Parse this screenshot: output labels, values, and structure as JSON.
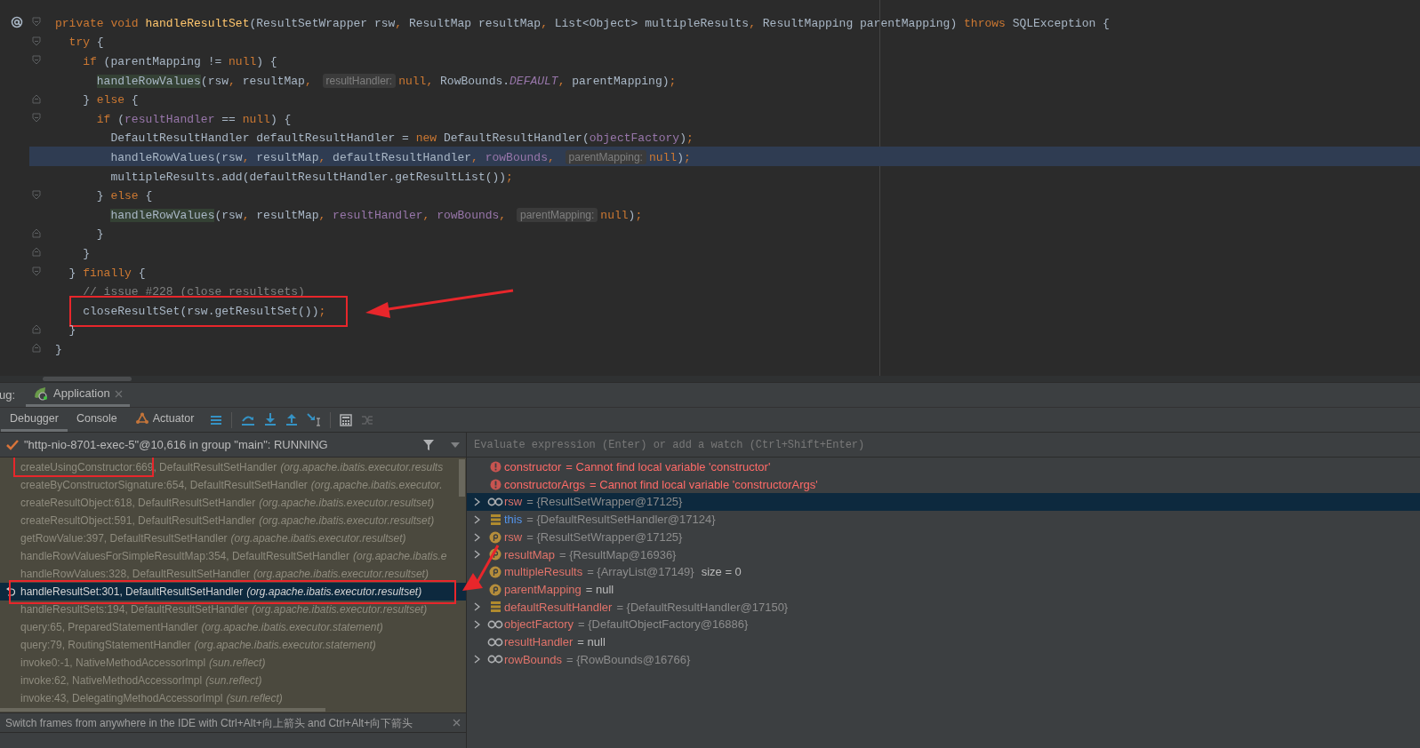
{
  "editor": {
    "lines": [
      {
        "override_marker": true,
        "fold": {
          "kind": "open"
        },
        "current": false,
        "boxed": false,
        "tokens": [
          {
            "kind": "kw",
            "text": "private void "
          },
          {
            "kind": "decl",
            "text": "handleResultSet"
          },
          {
            "kind": "plain",
            "text": "(ResultSetWrapper rsw"
          },
          {
            "kind": "punct",
            "text": ", "
          },
          {
            "kind": "plain",
            "text": "ResultMap resultMap"
          },
          {
            "kind": "punct",
            "text": ", "
          },
          {
            "kind": "plain",
            "text": "List<Object> multipleResults"
          },
          {
            "kind": "punct",
            "text": ", "
          },
          {
            "kind": "plain",
            "text": "ResultMapping parentMapping) "
          },
          {
            "kind": "kw",
            "text": "throws "
          },
          {
            "kind": "plain",
            "text": "SQLException {"
          }
        ]
      },
      {
        "override_marker": false,
        "fold": {
          "kind": "open"
        },
        "current": false,
        "boxed": false,
        "tokens": [
          {
            "kind": "kw",
            "text": "  try "
          },
          {
            "kind": "plain",
            "text": "{"
          }
        ]
      },
      {
        "override_marker": false,
        "fold": {
          "kind": "open"
        },
        "current": false,
        "boxed": false,
        "tokens": [
          {
            "kind": "kw",
            "text": "    if "
          },
          {
            "kind": "plain",
            "text": "(parentMapping != "
          },
          {
            "kind": "kw",
            "text": "null"
          },
          {
            "kind": "plain",
            "text": ") {"
          }
        ]
      },
      {
        "override_marker": false,
        "current": false,
        "boxed": false,
        "tokens": [
          {
            "kind": "usage",
            "text": "      handleRowValues"
          },
          {
            "kind": "plain",
            "text": "(rsw"
          },
          {
            "kind": "punct",
            "text": ", "
          },
          {
            "kind": "plain",
            "text": "resultMap"
          },
          {
            "kind": "punct",
            "text": ", "
          },
          {
            "kind": "hint",
            "text": "resultHandler:"
          },
          {
            "kind": "kw",
            "text": "null"
          },
          {
            "kind": "punct",
            "text": ", "
          },
          {
            "kind": "plain",
            "text": "RowBounds."
          },
          {
            "kind": "const",
            "text": "DEFAULT"
          },
          {
            "kind": "punct",
            "text": ", "
          },
          {
            "kind": "plain",
            "text": "parentMapping)"
          },
          {
            "kind": "punct",
            "text": ";"
          }
        ]
      },
      {
        "override_marker": false,
        "fold": {
          "kind": "close"
        },
        "current": false,
        "boxed": false,
        "tokens": [
          {
            "kind": "plain",
            "text": "    } "
          },
          {
            "kind": "kw",
            "text": "else "
          },
          {
            "kind": "plain",
            "text": "{"
          }
        ]
      },
      {
        "override_marker": false,
        "fold": {
          "kind": "open"
        },
        "current": false,
        "boxed": false,
        "tokens": [
          {
            "kind": "kw",
            "text": "      if "
          },
          {
            "kind": "plain",
            "text": "("
          },
          {
            "kind": "field",
            "text": "resultHandler"
          },
          {
            "kind": "plain",
            "text": " == "
          },
          {
            "kind": "kw",
            "text": "null"
          },
          {
            "kind": "plain",
            "text": ") {"
          }
        ]
      },
      {
        "override_marker": false,
        "current": false,
        "boxed": false,
        "tokens": [
          {
            "kind": "plain",
            "text": "        DefaultResultHandler defaultResultHandler = "
          },
          {
            "kind": "kw",
            "text": "new "
          },
          {
            "kind": "plain",
            "text": "DefaultResultHandler("
          },
          {
            "kind": "field",
            "text": "objectFactory"
          },
          {
            "kind": "plain",
            "text": ")"
          },
          {
            "kind": "punct",
            "text": ";"
          }
        ]
      },
      {
        "override_marker": false,
        "current": true,
        "boxed": false,
        "tokens": [
          {
            "kind": "plain",
            "text": "        handleRowValues(rsw"
          },
          {
            "kind": "punct",
            "text": ", "
          },
          {
            "kind": "plain",
            "text": "resultMap"
          },
          {
            "kind": "punct",
            "text": ", "
          },
          {
            "kind": "plain",
            "text": "defaultResultHandler"
          },
          {
            "kind": "punct",
            "text": ", "
          },
          {
            "kind": "field",
            "text": "rowBounds"
          },
          {
            "kind": "punct",
            "text": ", "
          },
          {
            "kind": "hint",
            "text": "parentMapping:"
          },
          {
            "kind": "kw",
            "text": "null"
          },
          {
            "kind": "plain",
            "text": ")"
          },
          {
            "kind": "punct",
            "text": ";"
          }
        ]
      },
      {
        "override_marker": false,
        "current": false,
        "boxed": false,
        "tokens": [
          {
            "kind": "plain",
            "text": "        multipleResults.add(defaultResultHandler.getResultList())"
          },
          {
            "kind": "punct",
            "text": ";"
          }
        ]
      },
      {
        "override_marker": false,
        "fold": {
          "kind": "open"
        },
        "current": false,
        "boxed": false,
        "tokens": [
          {
            "kind": "plain",
            "text": "      } "
          },
          {
            "kind": "kw",
            "text": "else "
          },
          {
            "kind": "plain",
            "text": "{"
          }
        ]
      },
      {
        "override_marker": false,
        "current": false,
        "boxed": false,
        "tokens": [
          {
            "kind": "usage",
            "text": "        handleRowValues"
          },
          {
            "kind": "plain",
            "text": "(rsw"
          },
          {
            "kind": "punct",
            "text": ", "
          },
          {
            "kind": "plain",
            "text": "resultMap"
          },
          {
            "kind": "punct",
            "text": ", "
          },
          {
            "kind": "field",
            "text": "resultHandler"
          },
          {
            "kind": "punct",
            "text": ", "
          },
          {
            "kind": "field",
            "text": "rowBounds"
          },
          {
            "kind": "punct",
            "text": ", "
          },
          {
            "kind": "hint",
            "text": "parentMapping:"
          },
          {
            "kind": "kw",
            "text": "null"
          },
          {
            "kind": "plain",
            "text": ")"
          },
          {
            "kind": "punct",
            "text": ";"
          }
        ]
      },
      {
        "override_marker": false,
        "fold": {
          "kind": "close"
        },
        "current": false,
        "boxed": false,
        "tokens": [
          {
            "kind": "plain",
            "text": "      }"
          }
        ]
      },
      {
        "override_marker": false,
        "fold": {
          "kind": "close"
        },
        "current": false,
        "boxed": false,
        "tokens": [
          {
            "kind": "plain",
            "text": "    }"
          }
        ]
      },
      {
        "override_marker": false,
        "fold": {
          "kind": "open"
        },
        "current": false,
        "boxed": false,
        "tokens": [
          {
            "kind": "plain",
            "text": "  } "
          },
          {
            "kind": "kw",
            "text": "finally "
          },
          {
            "kind": "plain",
            "text": "{"
          }
        ]
      },
      {
        "override_marker": false,
        "current": false,
        "boxed": false,
        "tokens": [
          {
            "kind": "comment",
            "text": "    // issue #228 (close resultsets)"
          }
        ]
      },
      {
        "override_marker": false,
        "current": false,
        "boxed": true,
        "tokens": [
          {
            "kind": "plain",
            "text": "    closeResultSet(rsw.getResultSet())"
          },
          {
            "kind": "punct",
            "text": ";"
          }
        ]
      },
      {
        "override_marker": false,
        "fold": {
          "kind": "close"
        },
        "current": false,
        "boxed": false,
        "tokens": [
          {
            "kind": "plain",
            "text": "  }"
          }
        ]
      },
      {
        "override_marker": false,
        "fold": {
          "kind": "close"
        },
        "current": false,
        "boxed": false,
        "tokens": [
          {
            "kind": "plain",
            "text": "}"
          }
        ]
      }
    ]
  },
  "debug": {
    "title": "ug:",
    "sessions": [
      {
        "label": "Application",
        "selected": true
      }
    ],
    "tabs": [
      {
        "label": "Debugger",
        "selected": true,
        "kind": "plain"
      },
      {
        "label": "Console",
        "selected": false,
        "kind": "plain"
      },
      {
        "label": "Actuator",
        "selected": false,
        "kind": "actuator"
      }
    ],
    "thread": "\"http-nio-8701-exec-5\"@10,616 in group \"main\": RUNNING",
    "frames": [
      {
        "method": "createUsingConstructor:669, DefaultResultSetHandler",
        "package": "(org.apache.ibatis.executor.results",
        "selected": false,
        "boxed": true
      },
      {
        "method": "createByConstructorSignature:654, DefaultResultSetHandler",
        "package": "(org.apache.ibatis.executor.",
        "selected": false,
        "boxed": false
      },
      {
        "method": "createResultObject:618, DefaultResultSetHandler",
        "package": "(org.apache.ibatis.executor.resultset)",
        "selected": false,
        "boxed": false
      },
      {
        "method": "createResultObject:591, DefaultResultSetHandler",
        "package": "(org.apache.ibatis.executor.resultset)",
        "selected": false,
        "boxed": false
      },
      {
        "method": "getRowValue:397, DefaultResultSetHandler",
        "package": "(org.apache.ibatis.executor.resultset)",
        "selected": false,
        "boxed": false
      },
      {
        "method": "handleRowValuesForSimpleResultMap:354, DefaultResultSetHandler",
        "package": "(org.apache.ibatis.e",
        "selected": false,
        "boxed": false
      },
      {
        "method": "handleRowValues:328, DefaultResultSetHandler",
        "package": "(org.apache.ibatis.executor.resultset)",
        "selected": false,
        "boxed": false
      },
      {
        "method": "handleResultSet:301, DefaultResultSetHandler",
        "package": "(org.apache.ibatis.executor.resultset)",
        "selected": true,
        "boxed": true
      },
      {
        "method": "handleResultSets:194, DefaultResultSetHandler",
        "package": "(org.apache.ibatis.executor.resultset)",
        "selected": false,
        "boxed": false
      },
      {
        "method": "query:65, PreparedStatementHandler",
        "package": "(org.apache.ibatis.executor.statement)",
        "selected": false,
        "boxed": false
      },
      {
        "method": "query:79, RoutingStatementHandler",
        "package": "(org.apache.ibatis.executor.statement)",
        "selected": false,
        "boxed": false
      },
      {
        "method": "invoke0:-1, NativeMethodAccessorImpl",
        "package": "(sun.reflect)",
        "selected": false,
        "boxed": false
      },
      {
        "method": "invoke:62, NativeMethodAccessorImpl",
        "package": "(sun.reflect)",
        "selected": false,
        "boxed": false
      },
      {
        "method": "invoke:43, DelegatingMethodAccessorImpl",
        "package": "(sun.reflect)",
        "selected": false,
        "boxed": false
      }
    ],
    "hint": "Switch frames from anywhere in the IDE with Ctrl+Alt+向上箭头 and Ctrl+Alt+向下箭头",
    "evaluate": {
      "placeholder": "Evaluate expression (Enter) or add a watch (Ctrl+Shift+Enter)"
    },
    "variables": [
      {
        "kind": "error",
        "name": "constructor",
        "value": "= Cannot find local variable 'constructor'",
        "expandable": false,
        "selected": false,
        "literal": false
      },
      {
        "kind": "error",
        "name": "constructorArgs",
        "value": "= Cannot find local variable 'constructorArgs'",
        "expandable": false,
        "selected": false,
        "literal": false
      },
      {
        "kind": "watch",
        "name": "rsw",
        "value": "= {ResultSetWrapper@17125}",
        "expandable": true,
        "selected": true,
        "literal": false
      },
      {
        "kind": "self",
        "name": "this",
        "value": "= {DefaultResultSetHandler@17124}",
        "expandable": true,
        "selected": false,
        "literal": false
      },
      {
        "kind": "param",
        "name": "rsw",
        "value": "= {ResultSetWrapper@17125}",
        "expandable": true,
        "selected": false,
        "literal": false
      },
      {
        "kind": "param",
        "name": "resultMap",
        "value": "= {ResultMap@16936}",
        "expandable": true,
        "selected": false,
        "literal": false
      },
      {
        "kind": "param",
        "name": "multipleResults",
        "value": "= {ArrayList@17149}",
        "extra": "size = 0",
        "expandable": false,
        "selected": false,
        "literal": false
      },
      {
        "kind": "param",
        "name": "parentMapping",
        "value": "= null",
        "expandable": false,
        "selected": false,
        "literal": true
      },
      {
        "kind": "object",
        "name": "defaultResultHandler",
        "value": "= {DefaultResultHandler@17150}",
        "expandable": true,
        "selected": false,
        "literal": false
      },
      {
        "kind": "watch",
        "name": "objectFactory",
        "value": "= {DefaultObjectFactory@16886}",
        "expandable": true,
        "selected": false,
        "literal": false
      },
      {
        "kind": "watch",
        "name": "resultHandler",
        "value": "= null",
        "expandable": false,
        "selected": false,
        "literal": true
      },
      {
        "kind": "watch",
        "name": "rowBounds",
        "value": "= {RowBounds@16766}",
        "expandable": true,
        "selected": false,
        "literal": false
      }
    ]
  }
}
